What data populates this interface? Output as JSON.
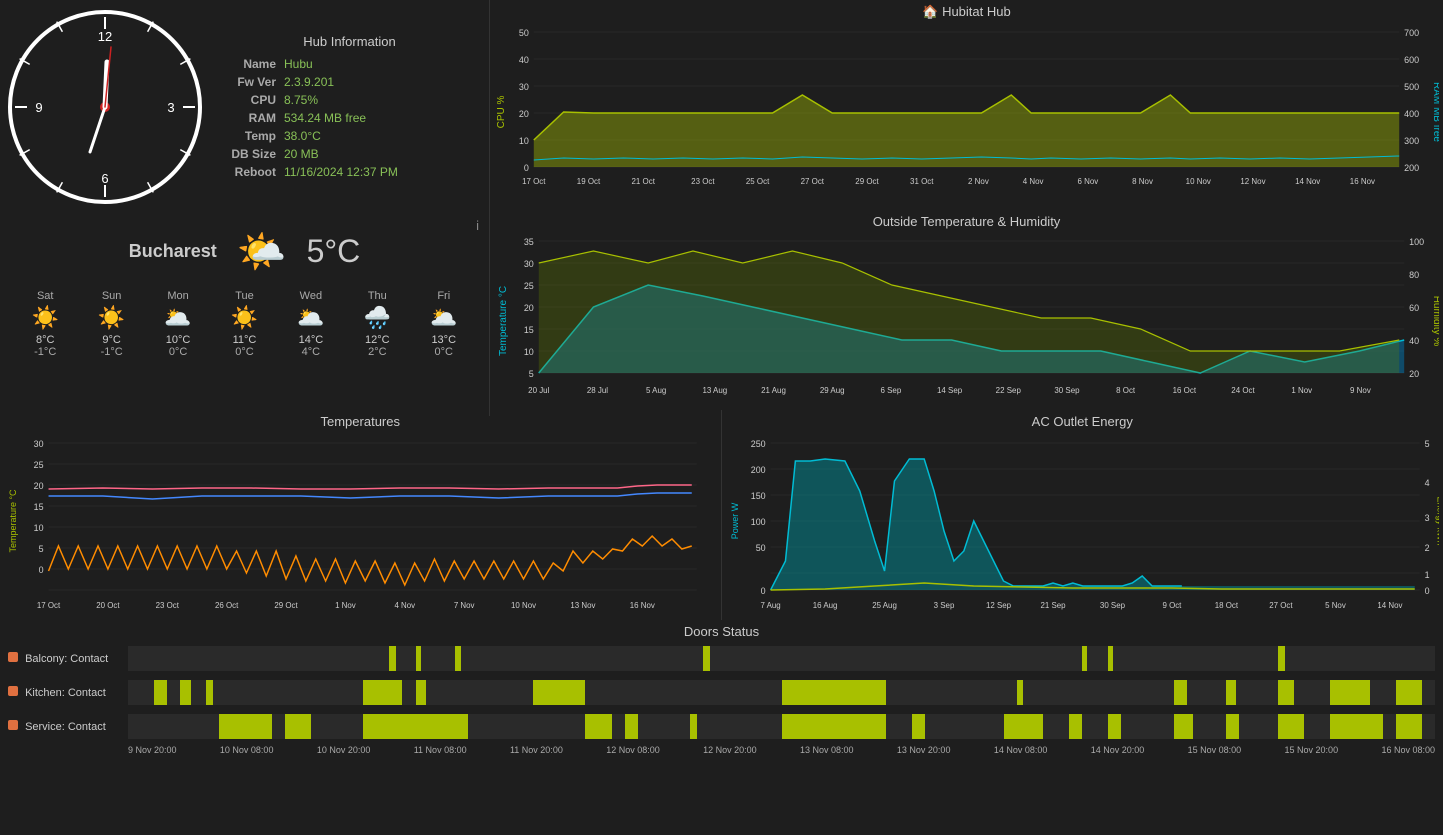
{
  "header": {
    "title": "Hub Information"
  },
  "hub": {
    "name_label": "Name",
    "name_value": "Hubu",
    "fw_label": "Fw Ver",
    "fw_value": "2.3.9.201",
    "cpu_label": "CPU",
    "cpu_value": "8.75%",
    "ram_label": "RAM",
    "ram_value": "534.24 MB free",
    "temp_label": "Temp",
    "temp_value": "38.0°C",
    "dbsize_label": "DB Size",
    "dbsize_value": "20 MB",
    "reboot_label": "Reboot",
    "reboot_value": "11/16/2024 12:37 PM"
  },
  "weather": {
    "city": "Bucharest",
    "temp": "5°C",
    "info_icon": "i",
    "forecast": [
      {
        "day": "Sat",
        "icon": "☀️",
        "high": "8°C",
        "low": "-1°C"
      },
      {
        "day": "Sun",
        "icon": "☀️",
        "high": "9°C",
        "low": "-1°C"
      },
      {
        "day": "Mon",
        "icon": "🌥️",
        "high": "10°C",
        "low": "0°C"
      },
      {
        "day": "Tue",
        "icon": "☀️",
        "high": "11°C",
        "low": "0°C"
      },
      {
        "day": "Wed",
        "icon": "🌥️",
        "high": "14°C",
        "low": "4°C"
      },
      {
        "day": "Thu",
        "icon": "🌧️",
        "high": "12°C",
        "low": "2°C"
      },
      {
        "day": "Fri",
        "icon": "🌥️",
        "high": "13°C",
        "low": "0°C"
      }
    ]
  },
  "hub_chart": {
    "title": "🏠 Hubitat Hub",
    "y1_label": "CPU %",
    "y2_label": "RAM MB free",
    "x_labels": [
      "17 Oct",
      "19 Oct",
      "21 Oct",
      "23 Oct",
      "25 Oct",
      "27 Oct",
      "29 Oct",
      "31 Oct",
      "2 Nov",
      "4 Nov",
      "6 Nov",
      "8 Nov",
      "10 Nov",
      "12 Nov",
      "14 Nov",
      "16 Nov"
    ]
  },
  "outside_chart": {
    "title": "Outside Temperature & Humidity",
    "y1_label": "Temperature °C",
    "y2_label": "Humidity %",
    "x_labels": [
      "20 Jul",
      "28 Jul",
      "5 Aug",
      "13 Aug",
      "21 Aug",
      "29 Aug",
      "6 Sep",
      "14 Sep",
      "22 Sep",
      "30 Sep",
      "8 Oct",
      "16 Oct",
      "24 Oct",
      "1 Nov",
      "9 Nov"
    ]
  },
  "temps_chart": {
    "title": "Temperatures",
    "y_label": "Temperature °C",
    "x_labels": [
      "17 Oct",
      "20 Oct",
      "23 Oct",
      "26 Oct",
      "29 Oct",
      "1 Nov",
      "4 Nov",
      "7 Nov",
      "10 Nov",
      "13 Nov",
      "16 Nov"
    ]
  },
  "ac_chart": {
    "title": "AC Outlet Energy",
    "y1_label": "Power W",
    "y2_label": "Energy kWh",
    "x_labels": [
      "7 Aug",
      "16 Aug",
      "25 Aug",
      "3 Sep",
      "12 Sep",
      "21 Sep",
      "30 Sep",
      "9 Oct",
      "18 Oct",
      "27 Oct",
      "5 Nov",
      "14 Nov"
    ]
  },
  "doors": {
    "title": "Doors Status",
    "sensors": [
      {
        "label": "Balcony: Contact",
        "color": "#e07040"
      },
      {
        "label": "Kitchen: Contact",
        "color": "#e07040"
      },
      {
        "label": "Service: Contact",
        "color": "#e07040"
      }
    ],
    "x_labels": [
      "9 Nov 20:00",
      "10 Nov 08:00",
      "10 Nov 20:00",
      "11 Nov 08:00",
      "11 Nov 20:00",
      "12 Nov 08:00",
      "12 Nov 20:00",
      "13 Nov 08:00",
      "13 Nov 20:00",
      "14 Nov 08:00",
      "14 Nov 20:00",
      "15 Nov 08:00",
      "15 Nov 20:00",
      "16 Nov 08:00"
    ]
  }
}
